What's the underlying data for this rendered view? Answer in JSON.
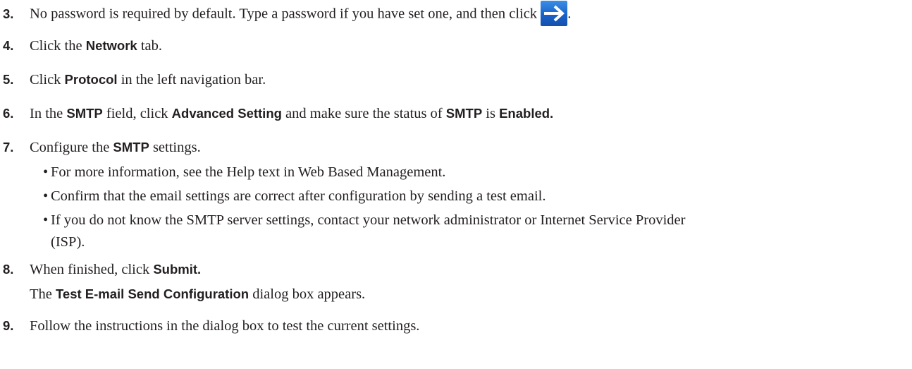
{
  "steps": [
    {
      "num": "3.",
      "parts": [
        "No password is required by default. Type a password if you have set one, and then click ",
        "."
      ],
      "icon": "right-arrow-button-icon"
    },
    {
      "num": "4.",
      "parts": [
        "Click the ",
        "Network",
        " tab."
      ]
    },
    {
      "num": "5.",
      "parts": [
        "Click ",
        "Protocol",
        " in the left navigation bar."
      ]
    },
    {
      "num": "6.",
      "parts": [
        "In the ",
        "SMTP",
        " field, click ",
        "Advanced Setting",
        " and make sure the status of ",
        "SMTP",
        " is ",
        "Enabled."
      ]
    },
    {
      "num": "7.",
      "parts": [
        "Configure the ",
        "SMTP",
        " settings."
      ]
    },
    {
      "num": "8.",
      "parts": [
        "When finished, click ",
        "Submit."
      ]
    },
    {
      "num": "9.",
      "parts": [
        "Follow the instructions in the dialog box to test the current settings."
      ]
    }
  ],
  "bullets": [
    "For more information, see the Help text in Web Based Management.",
    "Confirm that the email settings are correct after configuration by sending a test email.",
    "If you do not know the SMTP server settings, contact your network administrator or Internet Service Provider",
    "(ISP)."
  ],
  "step8_note": [
    "The ",
    "Test E-mail Send Configuration",
    " dialog box appears."
  ],
  "colors": {
    "text": "#231f20",
    "arrow_button": "#1a62c8"
  }
}
